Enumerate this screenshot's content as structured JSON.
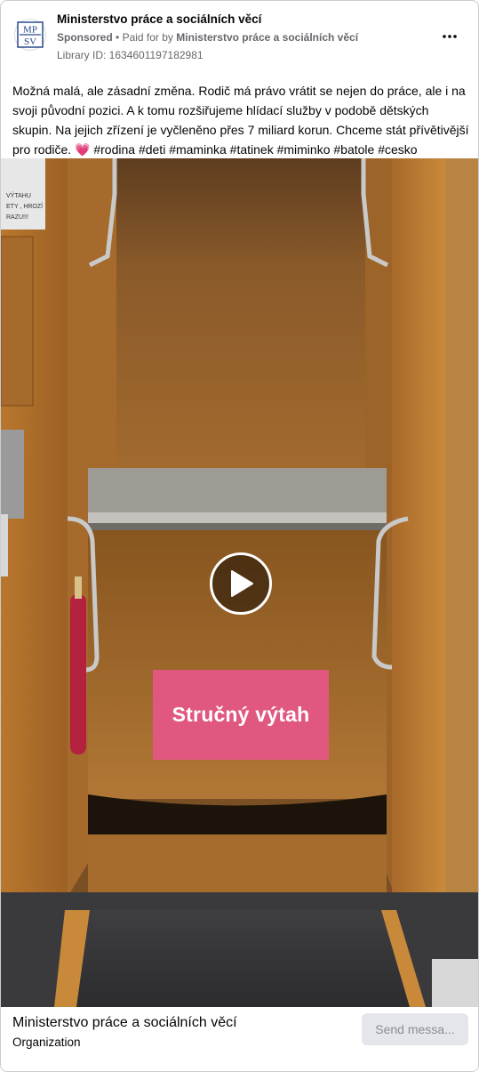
{
  "advertiser": {
    "logo_text_top": "MP",
    "logo_text_bottom": "SV",
    "name": "Ministerstvo práce a sociálních věcí",
    "sponsored_label": "Sponsored",
    "separator": "•",
    "paid_for_prefix": "Paid for by",
    "paid_for_name": "Ministerstvo práce a sociálních věcí",
    "library_id": "Library ID: 1634601197182981"
  },
  "more_button_icon": "more-horizontal-icon",
  "post": {
    "text": "Možná malá, ale zásadní změna. Rodič má právo vrátit se nejen do práce, ale i na svoji původní pozici. A k tomu rozšiřujeme hlídací služby v podobě dětských skupin. Na jejich zřízení je vyčleněno přes 7 miliard korun. Chceme stát přívětivější pro rodiče. 💗 #rodina #deti #maminka #tatinek #miminko #batole #cesko"
  },
  "video": {
    "caption": "Stručný výtah",
    "caption_color": "#e05880",
    "play_icon": "play-icon",
    "sign_lines": [
      "VÝTAHU",
      "ETY , HROZÍ",
      "RAZU!!!"
    ]
  },
  "footer": {
    "name": "Ministerstvo práce a sociálních věcí",
    "category": "Organization",
    "button_label": "Send messa..."
  }
}
